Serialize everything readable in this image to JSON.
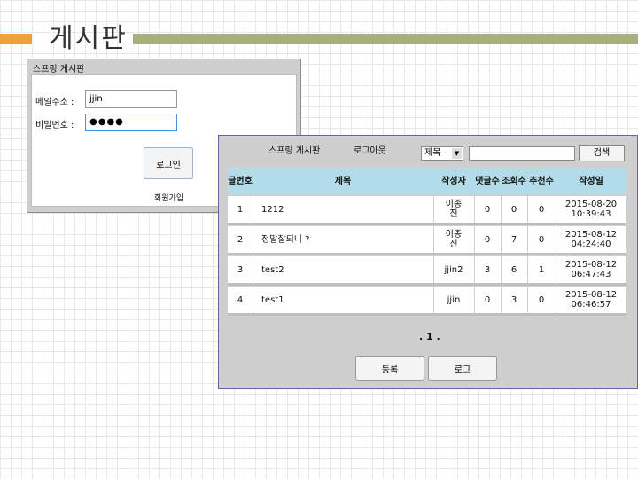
{
  "slide": {
    "title": "게시판"
  },
  "login": {
    "window_title": "스프링 게시판",
    "id_label": "메일주소 :",
    "id_value": "jjin",
    "pw_label": "비밀번호 :",
    "pw_value": "●●●●",
    "login_button": "로그인",
    "join_link": "회원가입"
  },
  "board": {
    "title": "스프링 게시판",
    "logout_link": "로그아웃",
    "search_select": "제목",
    "search_button": "검색",
    "columns": [
      "글번호",
      "제목",
      "작성자",
      "댓글수",
      "조회수",
      "추천수",
      "작성일"
    ],
    "rows": [
      {
        "no": "1",
        "title": "1212",
        "author": "이종진",
        "comments": "0",
        "views": "0",
        "likes": "0",
        "date": "2015-08-20 10:39:43"
      },
      {
        "no": "2",
        "title": "정말잘되니 ?",
        "author": "이종진",
        "comments": "0",
        "views": "7",
        "likes": "0",
        "date": "2015-08-12 04:24:40"
      },
      {
        "no": "3",
        "title": "test2",
        "author": "jjin2",
        "comments": "3",
        "views": "6",
        "likes": "1",
        "date": "2015-08-12 06:47:43"
      },
      {
        "no": "4",
        "title": "test1",
        "author": "jjin",
        "comments": "0",
        "views": "3",
        "likes": "0",
        "date": "2015-08-12 06:46:57"
      }
    ],
    "pager": ". 1 .",
    "write_button": "등록",
    "logout_button": "로그"
  }
}
